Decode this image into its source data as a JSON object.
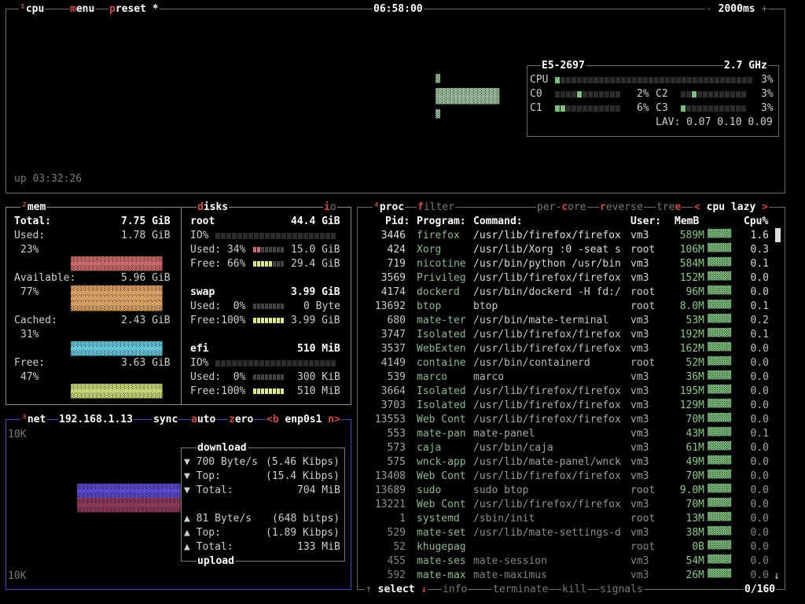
{
  "cpu": {
    "tab": "cpu",
    "menu": "menu",
    "preset": "preset",
    "preset_star": "*",
    "clock": "06:58:00",
    "rate": "2000ms",
    "rate_minus": "-",
    "rate_plus": "+",
    "uptime": "up 03:32:26",
    "model": "E5-2697",
    "freq": "2.7 GHz",
    "total_label": "CPU",
    "total_pct": "3%",
    "cores": [
      {
        "name": "C0",
        "pct": "2%"
      },
      {
        "name": "C1",
        "pct": "6%"
      },
      {
        "name": "C2",
        "pct": "3%"
      },
      {
        "name": "C3",
        "pct": "3%"
      }
    ],
    "lav_label": "LAV:",
    "lav": "0.07 0.10 0.09"
  },
  "mem": {
    "tab": "mem",
    "total_label": "Total:",
    "total": "7.75 GiB",
    "used_label": "Used:",
    "used": "1.78 GiB",
    "used_pct": "23%",
    "avail_label": "Available:",
    "avail": "5.96 GiB",
    "avail_pct": "77%",
    "cached_label": "Cached:",
    "cached": "2.43 GiB",
    "cached_pct": "31%",
    "free_label": "Free:",
    "free": "3.63 GiB",
    "free_pct": "47%"
  },
  "disks": {
    "tab": "disks",
    "io_tab": "io",
    "root": {
      "name": "root",
      "size": "44.4 GiB",
      "io": "IO%",
      "used": "Used: 34%",
      "used_val": "15.0 GiB",
      "free": "Free: 66%",
      "free_val": "29.4 GiB"
    },
    "swap": {
      "name": "swap",
      "size": "3.99 GiB",
      "used": "Used:  0%",
      "used_val": "0 Byte",
      "free": "Free:100%",
      "free_val": "3.99 GiB"
    },
    "efi": {
      "name": "efi",
      "size": "510 MiB",
      "io": "IO%",
      "used": "Used:  0%",
      "used_val": "300 KiB",
      "free": "Free:100%",
      "free_val": "510 MiB"
    }
  },
  "net": {
    "tab": "net",
    "ip": "192.168.1.13",
    "sync": "sync",
    "auto": "auto",
    "zero": "zero",
    "prev": "<b",
    "iface": "enp0s1",
    "next": "n>",
    "scale_top": "10K",
    "scale_bottom": "10K",
    "download_title": "download",
    "upload_title": "upload",
    "dl_rate": "700 Byte/s",
    "dl_rate_bits": "(5.46 Kibps)",
    "dl_top_label": "Top:",
    "dl_top": "(15.4 Kibps)",
    "dl_total_label": "Total:",
    "dl_total": "704 MiB",
    "ul_rate": "81 Byte/s",
    "ul_rate_bits": "(648 bitps)",
    "ul_top_label": "Top:",
    "ul_top": "(1.89 Kibps)",
    "ul_total_label": "Total:",
    "ul_total": "133 MiB",
    "arrow_down": "▼",
    "arrow_up": "▲"
  },
  "proc": {
    "tab": "proc",
    "filter": "filter",
    "per_core": "per-core",
    "reverse": "reverse",
    "tree": "tree",
    "sort": "cpu lazy",
    "sort_prev": "<",
    "sort_next": ">",
    "headers": {
      "pid": "Pid:",
      "program": "Program:",
      "command": "Command:",
      "user": "User:",
      "memb": "MemB",
      "cpu": "Cpu%"
    },
    "rows": [
      {
        "pid": "3446",
        "program": "firefox",
        "command": "/usr/lib/firefox/firefox",
        "user": "vm3",
        "mem": "589M",
        "cpu": "1.6"
      },
      {
        "pid": "424",
        "program": "Xorg",
        "command": "/usr/lib/Xorg :0 -seat s",
        "user": "root",
        "mem": "106M",
        "cpu": "0.3"
      },
      {
        "pid": "719",
        "program": "nicotine",
        "command": "/usr/bin/python /usr/bin",
        "user": "vm3",
        "mem": "584M",
        "cpu": "0.1"
      },
      {
        "pid": "3569",
        "program": "Privileg",
        "command": "/usr/lib/firefox/firefox",
        "user": "vm3",
        "mem": "152M",
        "cpu": "0.0"
      },
      {
        "pid": "4174",
        "program": "dockerd",
        "command": "/usr/bin/dockerd -H fd:/",
        "user": "root",
        "mem": "96M",
        "cpu": "0.0"
      },
      {
        "pid": "13692",
        "program": "btop",
        "command": "btop",
        "user": "root",
        "mem": "8.0M",
        "cpu": "0.1"
      },
      {
        "pid": "680",
        "program": "mate-ter",
        "command": "/usr/bin/mate-terminal",
        "user": "vm3",
        "mem": "53M",
        "cpu": "0.2"
      },
      {
        "pid": "3747",
        "program": "Isolated",
        "command": "/usr/lib/firefox/firefox",
        "user": "vm3",
        "mem": "192M",
        "cpu": "0.1"
      },
      {
        "pid": "3537",
        "program": "WebExten",
        "command": "/usr/lib/firefox/firefox",
        "user": "vm3",
        "mem": "162M",
        "cpu": "0.0"
      },
      {
        "pid": "4149",
        "program": "containe",
        "command": "/usr/bin/containerd",
        "user": "root",
        "mem": "52M",
        "cpu": "0.0"
      },
      {
        "pid": "539",
        "program": "marco",
        "command": "marco",
        "user": "vm3",
        "mem": "36M",
        "cpu": "0.0"
      },
      {
        "pid": "3664",
        "program": "Isolated",
        "command": "/usr/lib/firefox/firefox",
        "user": "vm3",
        "mem": "195M",
        "cpu": "0.0"
      },
      {
        "pid": "3703",
        "program": "Isolated",
        "command": "/usr/lib/firefox/firefox",
        "user": "vm3",
        "mem": "129M",
        "cpu": "0.0"
      },
      {
        "pid": "13553",
        "program": "Web Cont",
        "command": "/usr/lib/firefox/firefox",
        "user": "vm3",
        "mem": "70M",
        "cpu": "0.0"
      },
      {
        "pid": "553",
        "program": "mate-pan",
        "command": "mate-panel",
        "user": "vm3",
        "mem": "43M",
        "cpu": "0.1"
      },
      {
        "pid": "573",
        "program": "caja",
        "command": "/usr/bin/caja",
        "user": "vm3",
        "mem": "61M",
        "cpu": "0.0"
      },
      {
        "pid": "575",
        "program": "wnck-app",
        "command": "/usr/lib/mate-panel/wnck",
        "user": "vm3",
        "mem": "49M",
        "cpu": "0.0"
      },
      {
        "pid": "13408",
        "program": "Web Cont",
        "command": "/usr/lib/firefox/firefox",
        "user": "vm3",
        "mem": "70M",
        "cpu": "0.0"
      },
      {
        "pid": "13689",
        "program": "sudo",
        "command": "sudo btop",
        "user": "root",
        "mem": "9.0M",
        "cpu": "0.0"
      },
      {
        "pid": "13221",
        "program": "Web Cont",
        "command": "/usr/lib/firefox/firefox",
        "user": "vm3",
        "mem": "70M",
        "cpu": "0.0"
      },
      {
        "pid": "1",
        "program": "systemd",
        "command": "/sbin/init",
        "user": "root",
        "mem": "13M",
        "cpu": "0.0"
      },
      {
        "pid": "529",
        "program": "mate-set",
        "command": "/usr/lib/mate-settings-d",
        "user": "vm3",
        "mem": "38M",
        "cpu": "0.0"
      },
      {
        "pid": "52",
        "program": "khugepag",
        "command": "",
        "user": "root",
        "mem": "0B",
        "cpu": "0.0"
      },
      {
        "pid": "455",
        "program": "mate-ses",
        "command": "mate-session",
        "user": "vm3",
        "mem": "54M",
        "cpu": "0.0"
      },
      {
        "pid": "592",
        "program": "mate-max",
        "command": "mate-maximus",
        "user": "vm3",
        "mem": "26M",
        "cpu": "0.0"
      }
    ],
    "footer": {
      "select": "select",
      "info": "info",
      "terminate": "terminate",
      "kill": "kill",
      "signals": "signals",
      "count": "0/160",
      "up_arrow": "↑",
      "down_arrow": "↓"
    }
  }
}
